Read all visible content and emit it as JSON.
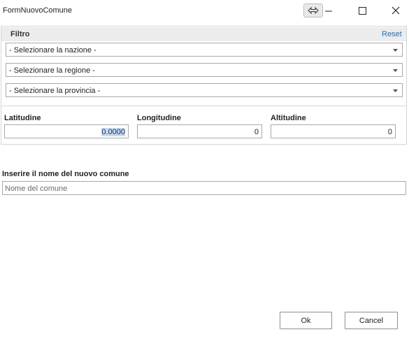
{
  "window": {
    "title": "FormNuovoComune",
    "buttons": {
      "swap_icon": "swap-horizontal-icon",
      "minimize_icon": "minimize-icon",
      "maximize_icon": "maximize-icon",
      "close_icon": "close-icon"
    }
  },
  "filter": {
    "title": "Filtro",
    "reset_label": "Reset",
    "selects": [
      {
        "selected": "- Selezionare la nazione -"
      },
      {
        "selected": "- Selezionare la regione -"
      },
      {
        "selected": "- Selezionare la provincia -"
      }
    ]
  },
  "coordinates": {
    "latitude": {
      "label": "Latitudine",
      "value_prefix": "0",
      "value_selected": ".0000"
    },
    "longitude": {
      "label": "Longitudine",
      "value": "0"
    },
    "altitude": {
      "label": "Altitudine",
      "value": "0"
    }
  },
  "new_comune": {
    "label": "Inserire il nome del nuovo comune",
    "placeholder": "Nome del comune",
    "value": ""
  },
  "actions": {
    "ok_label": "Ok",
    "cancel_label": "Cancel"
  },
  "colors": {
    "link": "#1e6fc1",
    "panel_header": "#ececec",
    "border": "#a9a9a9"
  }
}
